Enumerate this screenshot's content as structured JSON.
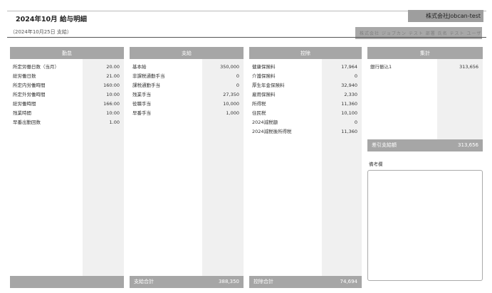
{
  "header": {
    "title": "2024年10月 給与明細",
    "subtitle": "（2024年10月25日 支給）",
    "company": "株式会社Jobcan-test",
    "masked_text": "株式会社 ジョブカン テスト 部署 氏名 テスト ユーザー"
  },
  "attendance": {
    "header": "勤怠",
    "items": [
      {
        "label": "所定労働日数（当月）",
        "value": "20.00"
      },
      {
        "label": "総労働日数",
        "value": "21.00"
      },
      {
        "label": "所定内労働時間",
        "value": "160:00"
      },
      {
        "label": "所定外労働時間",
        "value": "10:00"
      },
      {
        "label": "総労働時間",
        "value": "166:00"
      },
      {
        "label": "残業時間",
        "value": "10:00"
      },
      {
        "label": "早番出勤回数",
        "value": "1.00"
      }
    ]
  },
  "payments": {
    "header": "支給",
    "items": [
      {
        "label": "基本給",
        "value": "350,000"
      },
      {
        "label": "非課税通勤手当",
        "value": "0"
      },
      {
        "label": "課税通勤手当",
        "value": "0"
      },
      {
        "label": "残業手当",
        "value": "27,350"
      },
      {
        "label": "役職手当",
        "value": "10,000"
      },
      {
        "label": "早番手当",
        "value": "1,000"
      }
    ],
    "total_label": "支給合計",
    "total_value": "388,350"
  },
  "deductions": {
    "header": "控除",
    "items": [
      {
        "label": "健康保険料",
        "value": "17,964"
      },
      {
        "label": "介護保険料",
        "value": "0"
      },
      {
        "label": "厚生年金保険料",
        "value": "32,940"
      },
      {
        "label": "雇用保険料",
        "value": "2,330"
      },
      {
        "label": "所得税",
        "value": "11,360"
      },
      {
        "label": "住民税",
        "value": "10,100"
      },
      {
        "label": "2024減税額",
        "value": "0"
      },
      {
        "label": "2024減税後所得税",
        "value": "11,360"
      }
    ],
    "total_label": "控除合計",
    "total_value": "74,694"
  },
  "summary": {
    "header": "集計",
    "items": [
      {
        "label": "銀行振込1",
        "value": "313,656"
      }
    ],
    "net_label": "差引支給額",
    "net_value": "313,656",
    "remarks_label": "備考欄"
  }
}
